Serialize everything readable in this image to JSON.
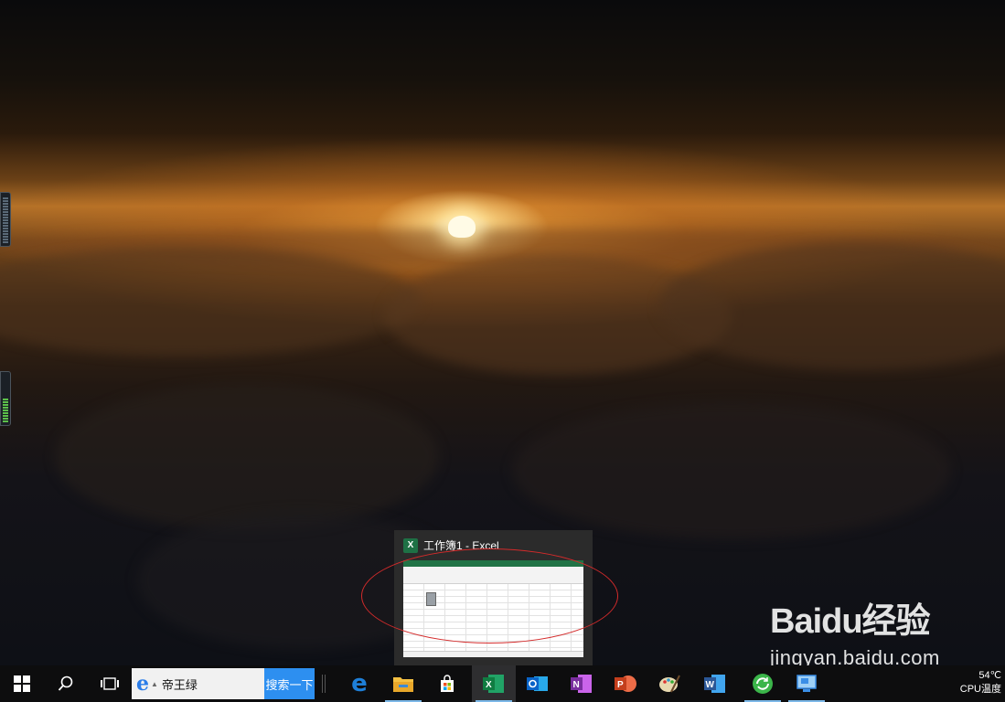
{
  "desktop": {
    "preview": {
      "app_name": "工作簿1 - Excel",
      "icon": "excel-icon",
      "accent": "#217346"
    }
  },
  "watermark": {
    "brand": "Baidu经验",
    "url": "jingyan.baidu.com"
  },
  "taskbar": {
    "start_icon": "windows-start-icon",
    "search_icon": "search-icon",
    "taskview_icon": "task-view-icon",
    "search_box": {
      "text": "帝王绿",
      "button_label": "搜索一下"
    },
    "apps": [
      {
        "name": "Edge",
        "icon": "edge-icon",
        "color": "#1e7fd8"
      },
      {
        "name": "File Explorer",
        "icon": "file-explorer-icon",
        "color": "#f4c042"
      },
      {
        "name": "Store",
        "icon": "store-icon",
        "color": "#ffffff"
      },
      {
        "name": "Excel",
        "icon": "excel-icon",
        "color": "#217346"
      },
      {
        "name": "Outlook",
        "icon": "outlook-icon",
        "color": "#0a64c8"
      },
      {
        "name": "OneNote",
        "icon": "onenote-icon",
        "color": "#7a2e9e"
      },
      {
        "name": "PowerPoint",
        "icon": "powerpoint-icon",
        "color": "#d04525"
      },
      {
        "name": "Paint",
        "icon": "paint-icon",
        "color": "#e8d9b0"
      },
      {
        "name": "Word",
        "icon": "word-icon",
        "color": "#2b5797"
      },
      {
        "name": "Refresh",
        "icon": "green-refresh-icon",
        "color": "#3bb54a"
      },
      {
        "name": "Remote",
        "icon": "remote-desktop-icon",
        "color": "#3a8ee6"
      }
    ],
    "tray": {
      "temperature": "54℃",
      "label": "CPU温度"
    }
  }
}
